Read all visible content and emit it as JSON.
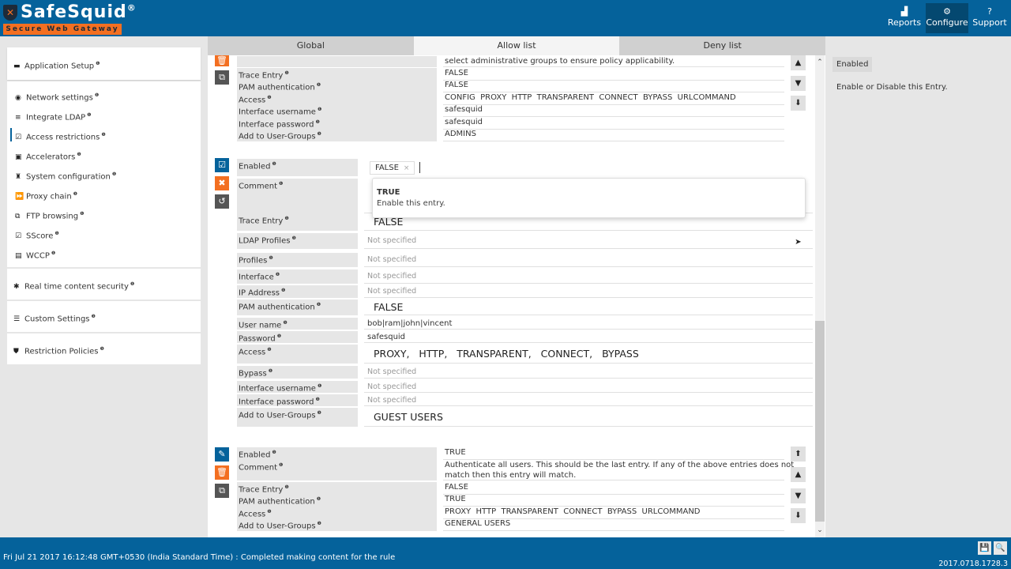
{
  "header": {
    "brand": "SafeSquid",
    "brand_mark": "®",
    "tagline": "Secure Web Gateway",
    "nav": [
      {
        "label": "Reports",
        "icon": "chart-icon",
        "glyph": "▟"
      },
      {
        "label": "Configure",
        "icon": "cogs-icon",
        "glyph": "⚙"
      },
      {
        "label": "Support",
        "icon": "question-icon",
        "glyph": "?"
      }
    ]
  },
  "sidebar": {
    "groups": [
      {
        "items": [
          {
            "label": "Application Setup",
            "glyph": "▬"
          }
        ]
      },
      {
        "items": [
          {
            "label": "Network settings",
            "glyph": "◉"
          },
          {
            "label": "Integrate LDAP",
            "glyph": "≡"
          },
          {
            "label": "Access restrictions",
            "glyph": "☑",
            "active": true
          },
          {
            "label": "Accelerators",
            "glyph": "▣"
          },
          {
            "label": "System configuration",
            "glyph": "♜"
          },
          {
            "label": "Proxy chain",
            "glyph": "⏩"
          },
          {
            "label": "FTP browsing",
            "glyph": "⧉"
          },
          {
            "label": "SScore",
            "glyph": "☑"
          },
          {
            "label": "WCCP",
            "glyph": "▤"
          }
        ]
      },
      {
        "items": [
          {
            "label": "Real time content security",
            "glyph": "✱"
          }
        ]
      },
      {
        "items": [
          {
            "label": "Custom Settings",
            "glyph": "☰"
          }
        ]
      },
      {
        "items": [
          {
            "label": "Restriction Policies",
            "glyph": "⛊"
          }
        ]
      }
    ]
  },
  "tabs": [
    {
      "label": "Global",
      "active": false
    },
    {
      "label": "Allow list",
      "active": true
    },
    {
      "label": "Deny list",
      "active": false
    }
  ],
  "rule1": {
    "rows": [
      {
        "label": "",
        "value": "select administrative groups to ensure policy applicability."
      },
      {
        "label": "Trace Entry",
        "value": "FALSE"
      },
      {
        "label": "PAM authentication",
        "value": "FALSE"
      },
      {
        "label": "Access",
        "value": "CONFIG  PROXY  HTTP  TRANSPARENT  CONNECT  BYPASS  URLCOMMAND"
      },
      {
        "label": "Interface username",
        "value": "safesquid"
      },
      {
        "label": "Interface password",
        "value": "safesquid"
      },
      {
        "label": "Add to User-Groups",
        "value": "ADMINS"
      }
    ]
  },
  "editor": {
    "enabled_label": "Enabled",
    "enabled_chip": "FALSE",
    "chip_remove": "×",
    "comment_label": "Comment",
    "dropdown_option": {
      "title": "TRUE",
      "desc": "Enable this entry."
    },
    "rows": [
      {
        "label": "Trace Entry",
        "value": "FALSE",
        "style": "big"
      },
      {
        "label": "LDAP Profiles",
        "value": "Not specified",
        "style": "ns"
      },
      {
        "label": "Profiles",
        "value": "Not specified",
        "style": "ns"
      },
      {
        "label": "Interface",
        "value": "Not specified",
        "style": "ns"
      },
      {
        "label": "IP Address",
        "value": "Not specified",
        "style": "ns"
      },
      {
        "label": "PAM authentication",
        "value": "FALSE",
        "style": "big"
      },
      {
        "label": "User name",
        "value": "bob|ram|john|vincent",
        "style": "plain"
      },
      {
        "label": "Password",
        "value": "safesquid",
        "style": "plain"
      },
      {
        "label": "Access",
        "value": "PROXY,   HTTP,   TRANSPARENT,   CONNECT,   BYPASS",
        "style": "big"
      },
      {
        "label": "Bypass",
        "value": "Not specified",
        "style": "ns"
      },
      {
        "label": "Interface username",
        "value": "Not specified",
        "style": "ns"
      },
      {
        "label": "Interface password",
        "value": "Not specified",
        "style": "ns"
      },
      {
        "label": "Add to User-Groups",
        "value": "GUEST USERS",
        "style": "big"
      }
    ]
  },
  "rule3": {
    "rows": [
      {
        "label": "Enabled",
        "value": "TRUE"
      },
      {
        "label": "Comment",
        "value": "Authenticate all users. This should be the last entry. If any of the above entries does not",
        "value2": "match then this entry will match."
      },
      {
        "label": "Trace Entry",
        "value": "FALSE"
      },
      {
        "label": "PAM authentication",
        "value": "TRUE"
      },
      {
        "label": "Access",
        "value": "PROXY  HTTP  TRANSPARENT  CONNECT  BYPASS  URLCOMMAND"
      },
      {
        "label": "Add to User-Groups",
        "value": "GENERAL USERS"
      }
    ]
  },
  "help": {
    "title": "Enabled",
    "desc": "Enable or Disable this Entry."
  },
  "footer": {
    "status": "Fri Jul 21 2017 16:12:48 GMT+0530 (India Standard Time) : Completed making content for the rule",
    "version": "2017.0718.1728.3"
  }
}
